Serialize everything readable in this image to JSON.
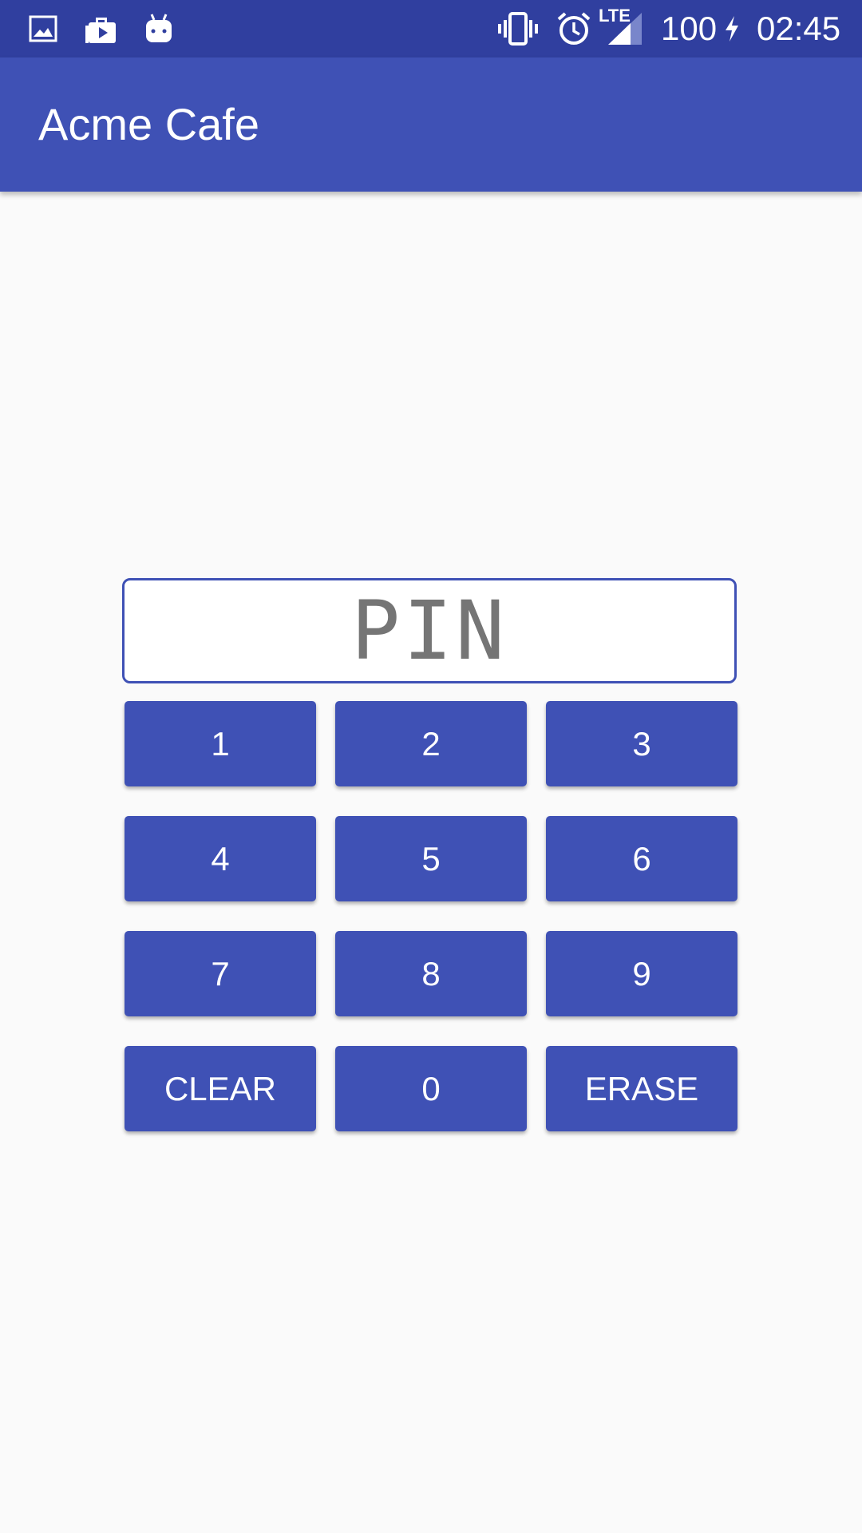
{
  "status_bar": {
    "battery": "100",
    "time": "02:45",
    "network": "LTE",
    "left_icons": [
      "image-icon",
      "play-store-icon",
      "android-icon"
    ],
    "right_icons": [
      "vibrate-icon",
      "alarm-icon",
      "signal-icon",
      "charging-icon"
    ]
  },
  "app_bar": {
    "title": "Acme Cafe"
  },
  "pin_field": {
    "placeholder": "PIN",
    "value": ""
  },
  "keypad": {
    "keys": [
      "1",
      "2",
      "3",
      "4",
      "5",
      "6",
      "7",
      "8",
      "9",
      "CLEAR",
      "0",
      "ERASE"
    ]
  },
  "colors": {
    "status_bar": "#303f9f",
    "primary": "#3f51b5",
    "background": "#fafafa",
    "placeholder_text": "#757575"
  }
}
